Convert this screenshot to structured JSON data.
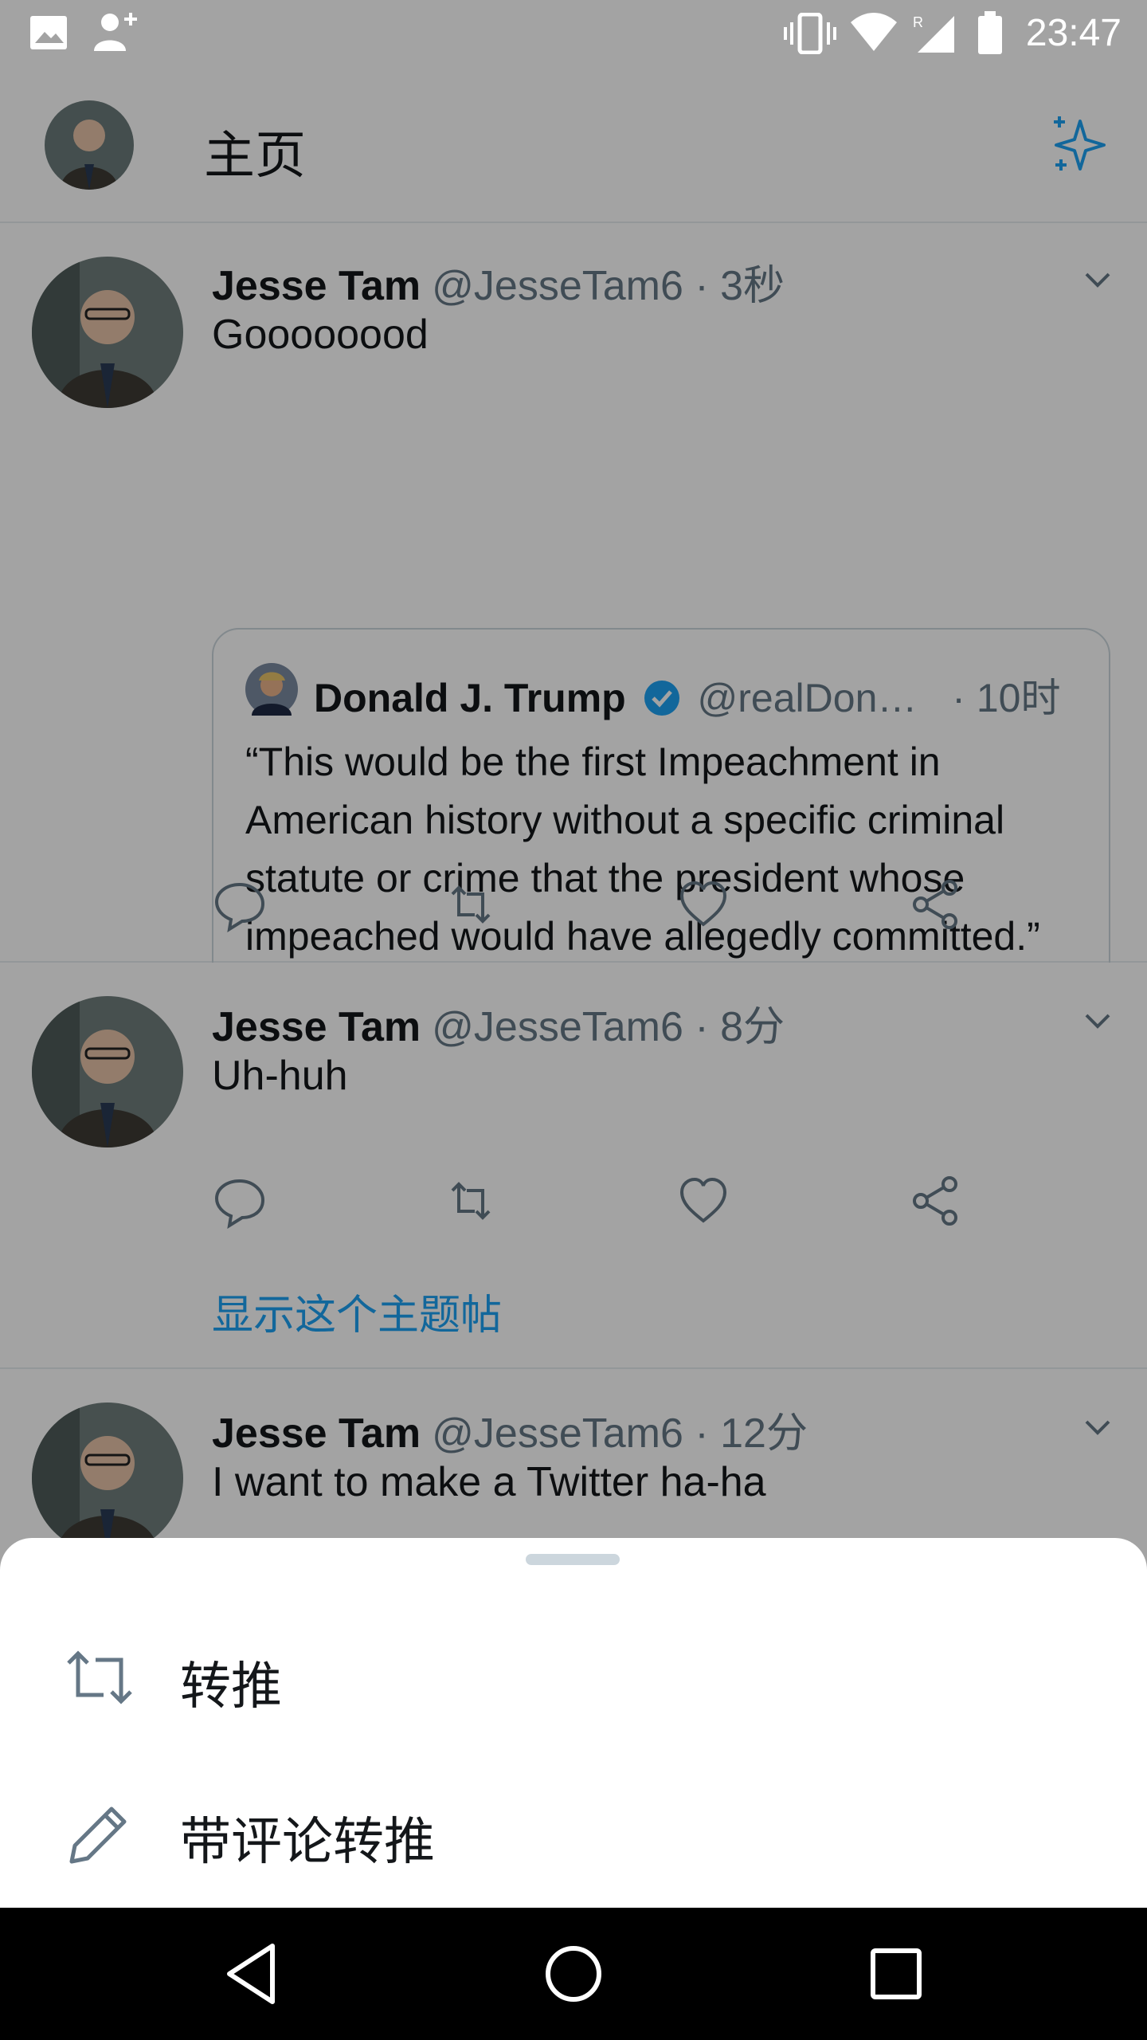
{
  "status_bar": {
    "time": "23:47"
  },
  "header": {
    "title": "主页"
  },
  "tweets": [
    {
      "name": "Jesse Tam",
      "handle": "@JesseTam6 · 3秒",
      "text": "Goooooood",
      "quote": {
        "name": "Donald J. Trump",
        "handle": "@realDon…",
        "time": "· 10时",
        "text": "“This would be the first Impeachment in American history without a specific criminal statute or crime that the president whose impeached would have allegedly committed.” Paul Gigot, The W…"
      }
    },
    {
      "name": "Jesse Tam",
      "handle": "@JesseTam6 · 8分",
      "text": "Uh-huh",
      "thread_link": "显示这个主题帖"
    },
    {
      "name": "Jesse Tam",
      "handle": "@JesseTam6 · 12分",
      "text": "I want to make a Twitter ha-ha"
    }
  ],
  "sheet": {
    "items": [
      {
        "label": "转推",
        "icon": "retweet-icon"
      },
      {
        "label": "带评论转推",
        "icon": "pencil-icon"
      }
    ]
  },
  "colors": {
    "accent": "#1da1f2",
    "verified": "#1da1f2",
    "overlay": "rgba(0,0,0,0.36)"
  }
}
